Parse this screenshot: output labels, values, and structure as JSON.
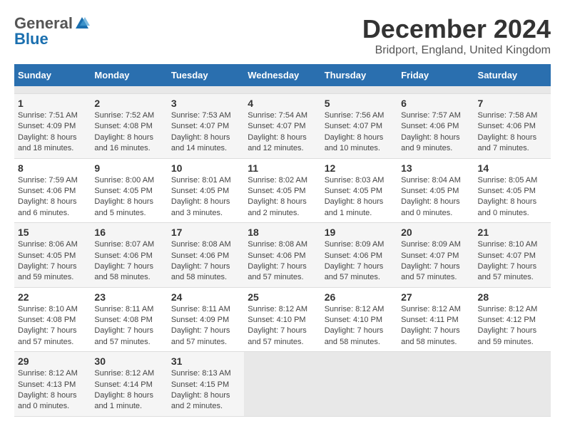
{
  "header": {
    "logo_general": "General",
    "logo_blue": "Blue",
    "main_title": "December 2024",
    "subtitle": "Bridport, England, United Kingdom"
  },
  "calendar": {
    "days_of_week": [
      "Sunday",
      "Monday",
      "Tuesday",
      "Wednesday",
      "Thursday",
      "Friday",
      "Saturday"
    ],
    "weeks": [
      [
        {
          "day": "",
          "empty": true
        },
        {
          "day": "",
          "empty": true
        },
        {
          "day": "",
          "empty": true
        },
        {
          "day": "",
          "empty": true
        },
        {
          "day": "",
          "empty": true
        },
        {
          "day": "",
          "empty": true
        },
        {
          "day": "",
          "empty": true
        }
      ],
      [
        {
          "day": "1",
          "sunrise": "Sunrise: 7:51 AM",
          "sunset": "Sunset: 4:09 PM",
          "daylight": "Daylight: 8 hours and 18 minutes."
        },
        {
          "day": "2",
          "sunrise": "Sunrise: 7:52 AM",
          "sunset": "Sunset: 4:08 PM",
          "daylight": "Daylight: 8 hours and 16 minutes."
        },
        {
          "day": "3",
          "sunrise": "Sunrise: 7:53 AM",
          "sunset": "Sunset: 4:07 PM",
          "daylight": "Daylight: 8 hours and 14 minutes."
        },
        {
          "day": "4",
          "sunrise": "Sunrise: 7:54 AM",
          "sunset": "Sunset: 4:07 PM",
          "daylight": "Daylight: 8 hours and 12 minutes."
        },
        {
          "day": "5",
          "sunrise": "Sunrise: 7:56 AM",
          "sunset": "Sunset: 4:07 PM",
          "daylight": "Daylight: 8 hours and 10 minutes."
        },
        {
          "day": "6",
          "sunrise": "Sunrise: 7:57 AM",
          "sunset": "Sunset: 4:06 PM",
          "daylight": "Daylight: 8 hours and 9 minutes."
        },
        {
          "day": "7",
          "sunrise": "Sunrise: 7:58 AM",
          "sunset": "Sunset: 4:06 PM",
          "daylight": "Daylight: 8 hours and 7 minutes."
        }
      ],
      [
        {
          "day": "8",
          "sunrise": "Sunrise: 7:59 AM",
          "sunset": "Sunset: 4:06 PM",
          "daylight": "Daylight: 8 hours and 6 minutes."
        },
        {
          "day": "9",
          "sunrise": "Sunrise: 8:00 AM",
          "sunset": "Sunset: 4:05 PM",
          "daylight": "Daylight: 8 hours and 5 minutes."
        },
        {
          "day": "10",
          "sunrise": "Sunrise: 8:01 AM",
          "sunset": "Sunset: 4:05 PM",
          "daylight": "Daylight: 8 hours and 3 minutes."
        },
        {
          "day": "11",
          "sunrise": "Sunrise: 8:02 AM",
          "sunset": "Sunset: 4:05 PM",
          "daylight": "Daylight: 8 hours and 2 minutes."
        },
        {
          "day": "12",
          "sunrise": "Sunrise: 8:03 AM",
          "sunset": "Sunset: 4:05 PM",
          "daylight": "Daylight: 8 hours and 1 minute."
        },
        {
          "day": "13",
          "sunrise": "Sunrise: 8:04 AM",
          "sunset": "Sunset: 4:05 PM",
          "daylight": "Daylight: 8 hours and 0 minutes."
        },
        {
          "day": "14",
          "sunrise": "Sunrise: 8:05 AM",
          "sunset": "Sunset: 4:05 PM",
          "daylight": "Daylight: 8 hours and 0 minutes."
        }
      ],
      [
        {
          "day": "15",
          "sunrise": "Sunrise: 8:06 AM",
          "sunset": "Sunset: 4:05 PM",
          "daylight": "Daylight: 7 hours and 59 minutes."
        },
        {
          "day": "16",
          "sunrise": "Sunrise: 8:07 AM",
          "sunset": "Sunset: 4:06 PM",
          "daylight": "Daylight: 7 hours and 58 minutes."
        },
        {
          "day": "17",
          "sunrise": "Sunrise: 8:08 AM",
          "sunset": "Sunset: 4:06 PM",
          "daylight": "Daylight: 7 hours and 58 minutes."
        },
        {
          "day": "18",
          "sunrise": "Sunrise: 8:08 AM",
          "sunset": "Sunset: 4:06 PM",
          "daylight": "Daylight: 7 hours and 57 minutes."
        },
        {
          "day": "19",
          "sunrise": "Sunrise: 8:09 AM",
          "sunset": "Sunset: 4:06 PM",
          "daylight": "Daylight: 7 hours and 57 minutes."
        },
        {
          "day": "20",
          "sunrise": "Sunrise: 8:09 AM",
          "sunset": "Sunset: 4:07 PM",
          "daylight": "Daylight: 7 hours and 57 minutes."
        },
        {
          "day": "21",
          "sunrise": "Sunrise: 8:10 AM",
          "sunset": "Sunset: 4:07 PM",
          "daylight": "Daylight: 7 hours and 57 minutes."
        }
      ],
      [
        {
          "day": "22",
          "sunrise": "Sunrise: 8:10 AM",
          "sunset": "Sunset: 4:08 PM",
          "daylight": "Daylight: 7 hours and 57 minutes."
        },
        {
          "day": "23",
          "sunrise": "Sunrise: 8:11 AM",
          "sunset": "Sunset: 4:08 PM",
          "daylight": "Daylight: 7 hours and 57 minutes."
        },
        {
          "day": "24",
          "sunrise": "Sunrise: 8:11 AM",
          "sunset": "Sunset: 4:09 PM",
          "daylight": "Daylight: 7 hours and 57 minutes."
        },
        {
          "day": "25",
          "sunrise": "Sunrise: 8:12 AM",
          "sunset": "Sunset: 4:10 PM",
          "daylight": "Daylight: 7 hours and 57 minutes."
        },
        {
          "day": "26",
          "sunrise": "Sunrise: 8:12 AM",
          "sunset": "Sunset: 4:10 PM",
          "daylight": "Daylight: 7 hours and 58 minutes."
        },
        {
          "day": "27",
          "sunrise": "Sunrise: 8:12 AM",
          "sunset": "Sunset: 4:11 PM",
          "daylight": "Daylight: 7 hours and 58 minutes."
        },
        {
          "day": "28",
          "sunrise": "Sunrise: 8:12 AM",
          "sunset": "Sunset: 4:12 PM",
          "daylight": "Daylight: 7 hours and 59 minutes."
        }
      ],
      [
        {
          "day": "29",
          "sunrise": "Sunrise: 8:12 AM",
          "sunset": "Sunset: 4:13 PM",
          "daylight": "Daylight: 8 hours and 0 minutes."
        },
        {
          "day": "30",
          "sunrise": "Sunrise: 8:12 AM",
          "sunset": "Sunset: 4:14 PM",
          "daylight": "Daylight: 8 hours and 1 minute."
        },
        {
          "day": "31",
          "sunrise": "Sunrise: 8:13 AM",
          "sunset": "Sunset: 4:15 PM",
          "daylight": "Daylight: 8 hours and 2 minutes."
        },
        {
          "day": "",
          "empty": true
        },
        {
          "day": "",
          "empty": true
        },
        {
          "day": "",
          "empty": true
        },
        {
          "day": "",
          "empty": true
        }
      ]
    ]
  }
}
